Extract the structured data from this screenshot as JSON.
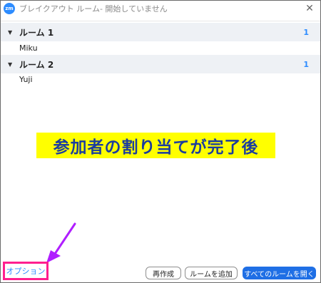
{
  "window": {
    "logo_text": "zm",
    "title": "ブレイクアウト ルーム- 開始していません",
    "close_glyph": "✕"
  },
  "rooms": [
    {
      "name": "ルーム 1",
      "count": "1",
      "members": [
        "Miku"
      ]
    },
    {
      "name": "ルーム 2",
      "count": "1",
      "members": [
        "Yuji"
      ]
    }
  ],
  "annotation": {
    "banner_text": "参加者の割り当てが完了後",
    "banner_color": "#ffff00",
    "banner_text_color": "#1b3d9e",
    "arrow_color": "#b01eff",
    "highlight_color": "#ff1f8f"
  },
  "footer": {
    "options_label": "オプション",
    "recreate_label": "再作成",
    "add_room_label": "ルームを追加",
    "open_all_label": "すべてのルームを開く"
  },
  "colors": {
    "accent": "#2d8cff",
    "primary_button": "#1f6fe5",
    "room_header_bg": "#eef1f5"
  }
}
